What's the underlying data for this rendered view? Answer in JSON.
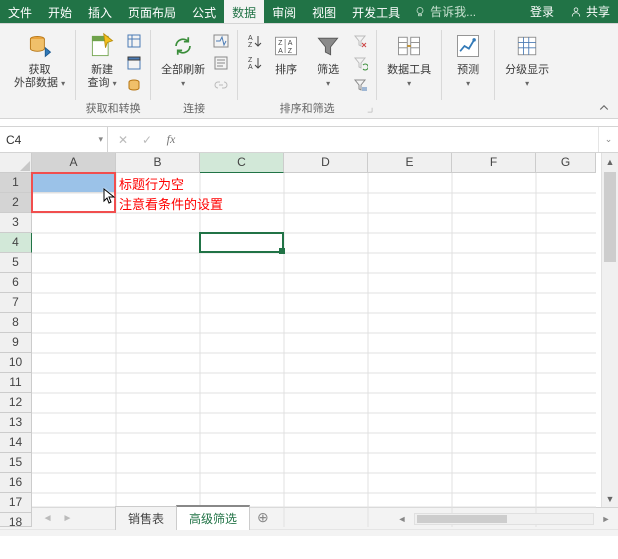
{
  "tabs": {
    "file": "文件",
    "home": "开始",
    "insert": "插入",
    "pageLayout": "页面布局",
    "formulas": "公式",
    "data": "数据",
    "review": "审阅",
    "view": "视图",
    "developer": "开发工具"
  },
  "tellme": "告诉我...",
  "login": "登录",
  "share": "共享",
  "ribbon": {
    "getExternalData": {
      "label": "获取\n外部数据",
      "group": ""
    },
    "newQuery": {
      "label": "新建\n查询",
      "group": "获取和转换"
    },
    "refreshAll": {
      "label": "全部刷新",
      "group": "连接"
    },
    "sort": {
      "label": "排序",
      "filter": "筛选",
      "group": "排序和筛选"
    },
    "dataTools": {
      "label": "数据工具"
    },
    "forecast": {
      "label": "预测"
    },
    "outline": {
      "label": "分级显示"
    }
  },
  "nameBox": "C4",
  "columns": [
    "A",
    "B",
    "C",
    "D",
    "E",
    "F",
    "G"
  ],
  "rows": [
    "1",
    "2",
    "3",
    "4",
    "5",
    "6",
    "7",
    "8",
    "9",
    "10",
    "11",
    "12",
    "13",
    "14",
    "15",
    "16",
    "17",
    "18"
  ],
  "annotations": {
    "line1": "标题行为空",
    "line2": "注意看条件的设置"
  },
  "sheets": {
    "s1": "销售表",
    "s2": "高级筛选"
  },
  "activeCell": "C4"
}
